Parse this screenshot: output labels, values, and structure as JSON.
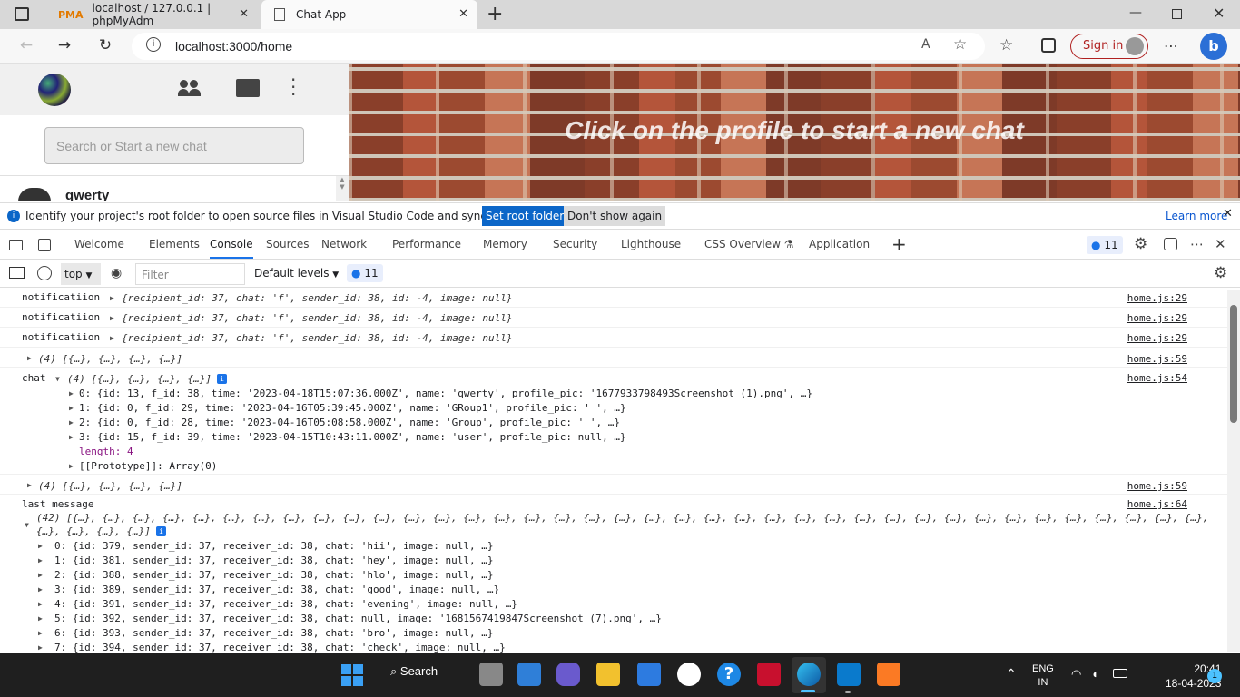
{
  "browser": {
    "tabs": [
      {
        "label": "localhost / 127.0.0.1 | phpMyAdm"
      },
      {
        "label": "Chat App"
      }
    ],
    "url": "localhost:3000/home",
    "signin_label": "Sign in"
  },
  "app": {
    "search_placeholder": "Search or Start a new chat",
    "contact_name": "qwerty",
    "banner_text": "Click on the profile to start a new chat"
  },
  "infobar": {
    "message": "Identify your project's root folder to open source files in Visual Studio Code and sync changes.",
    "set_root_label": "Set root folder",
    "dont_show_label": "Don't show again",
    "learn_more_label": "Learn more"
  },
  "devtools": {
    "tabs": [
      "Welcome",
      "Elements",
      "Console",
      "Sources",
      "Network",
      "Performance",
      "Memory",
      "Security",
      "Lighthouse",
      "CSS Overview",
      "Application"
    ],
    "issues_count": "11",
    "context": "top",
    "filter_placeholder": "Filter",
    "levels": "Default levels",
    "message_count": "11"
  },
  "console": {
    "notif_label": "notificatiion",
    "notif_obj": "{recipient_id: 37, chat: 'f', sender_id: 38, id: -4, image: null}",
    "src_29": "home.js:29",
    "arr4": "(4) [{…}, {…}, {…}, {…}]",
    "src_59": "home.js:59",
    "chat_label": "chat",
    "src_54": "home.js:54",
    "chat_items": [
      "0: {id: 13, f_id: 38, time: '2023-04-18T15:07:36.000Z', name: 'qwerty', profile_pic: '1677933798493Screenshot (1).png', …}",
      "1: {id: 0, f_id: 29, time: '2023-04-16T05:39:45.000Z', name: 'GRoup1', profile_pic: ' ', …}",
      "2: {id: 0, f_id: 28, time: '2023-04-16T05:08:58.000Z', name: 'Group', profile_pic: ' ', …}",
      "3: {id: 15, f_id: 39, time: '2023-04-15T10:43:11.000Z', name: 'user', profile_pic: null, …}"
    ],
    "length_line": "length: 4",
    "prototype_line": "[[Prototype]]: Array(0)",
    "last_message_label": "last message",
    "src_64": "home.js:64",
    "arr42_line1": "(42) [{…}, {…}, {…}, {…}, {…}, {…}, {…}, {…}, {…}, {…}, {…}, {…}, {…}, {…}, {…}, {…}, {…}, {…}, {…}, {…}, {…}, {…}, {…}, {…}, {…}, {…}, {…}, {…}, {…}, {…}, {…}, {…}, {…}, {…}, {…}, {…}, {…}, {…},",
    "arr42_line2": "{…}, {…}, {…}, {…}]",
    "msg_items": [
      "0: {id: 379, sender_id: 37, receiver_id: 38, chat: 'hii', image: null, …}",
      "1: {id: 381, sender_id: 37, receiver_id: 38, chat: 'hey', image: null, …}",
      "2: {id: 388, sender_id: 37, receiver_id: 38, chat: 'hlo', image: null, …}",
      "3: {id: 389, sender_id: 37, receiver_id: 38, chat: 'good', image: null, …}",
      "4: {id: 391, sender_id: 37, receiver_id: 38, chat: 'evening', image: null, …}",
      "5: {id: 392, sender_id: 37, receiver_id: 38, chat: null, image: '1681567419847Screenshot (7).png', …}",
      "6: {id: 393, sender_id: 37, receiver_id: 38, chat: 'bro', image: null, …}",
      "7: {id: 394, sender_id: 37, receiver_id: 38, chat: 'check', image: null, …}"
    ]
  },
  "taskbar": {
    "search_label": "Search",
    "lang1": "ENG",
    "lang2": "IN",
    "time": "20:41",
    "date": "18-04-2023",
    "notif_count": "1"
  }
}
